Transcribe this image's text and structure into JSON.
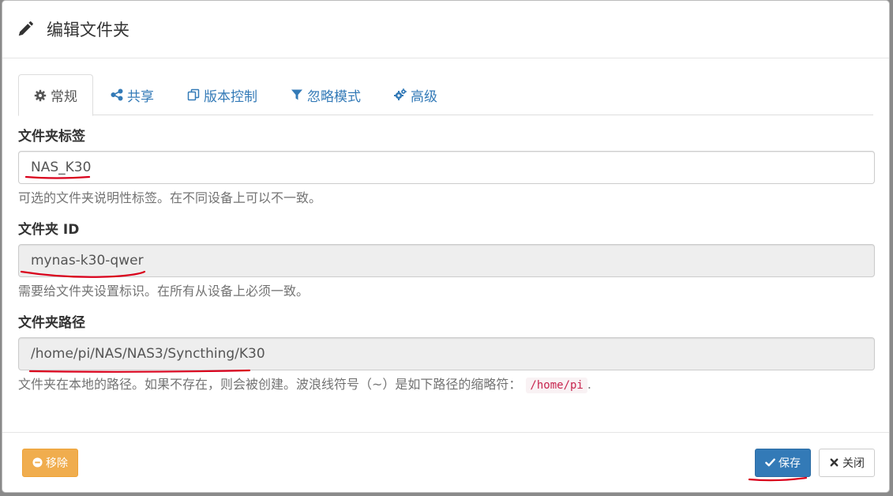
{
  "dialog": {
    "title": "编辑文件夹",
    "title_icon": "pencil-icon"
  },
  "tabs": [
    {
      "label": "常规",
      "icon": "gear-icon",
      "active": true
    },
    {
      "label": "共享",
      "icon": "share-icon",
      "active": false
    },
    {
      "label": "版本控制",
      "icon": "copy-icon",
      "active": false
    },
    {
      "label": "忽略模式",
      "icon": "filter-icon",
      "active": false
    },
    {
      "label": "高级",
      "icon": "cogs-icon",
      "active": false
    }
  ],
  "fields": {
    "label": {
      "title": "文件夹标签",
      "value": "NAS_K30",
      "help": "可选的文件夹说明性标签。在不同设备上可以不一致。"
    },
    "id": {
      "title": "文件夹 ID",
      "value": "mynas-k30-qwer",
      "help": "需要给文件夹设置标识。在所有从设备上必须一致。"
    },
    "path": {
      "title": "文件夹路径",
      "value": "/home/pi/NAS/NAS3/Syncthing/K30",
      "help": "文件夹在本地的路径。如果不存在，则会被创建。波浪线符号（~）是如下路径的缩略符：",
      "help_code": "/home/pi",
      "help_end": "."
    }
  },
  "footer": {
    "remove_label": "移除",
    "save_label": "保存",
    "close_label": "关闭"
  },
  "colors": {
    "link": "#337ab7",
    "warning": "#f0ad4e",
    "primary": "#337ab7",
    "annotation": "#d9001b"
  }
}
